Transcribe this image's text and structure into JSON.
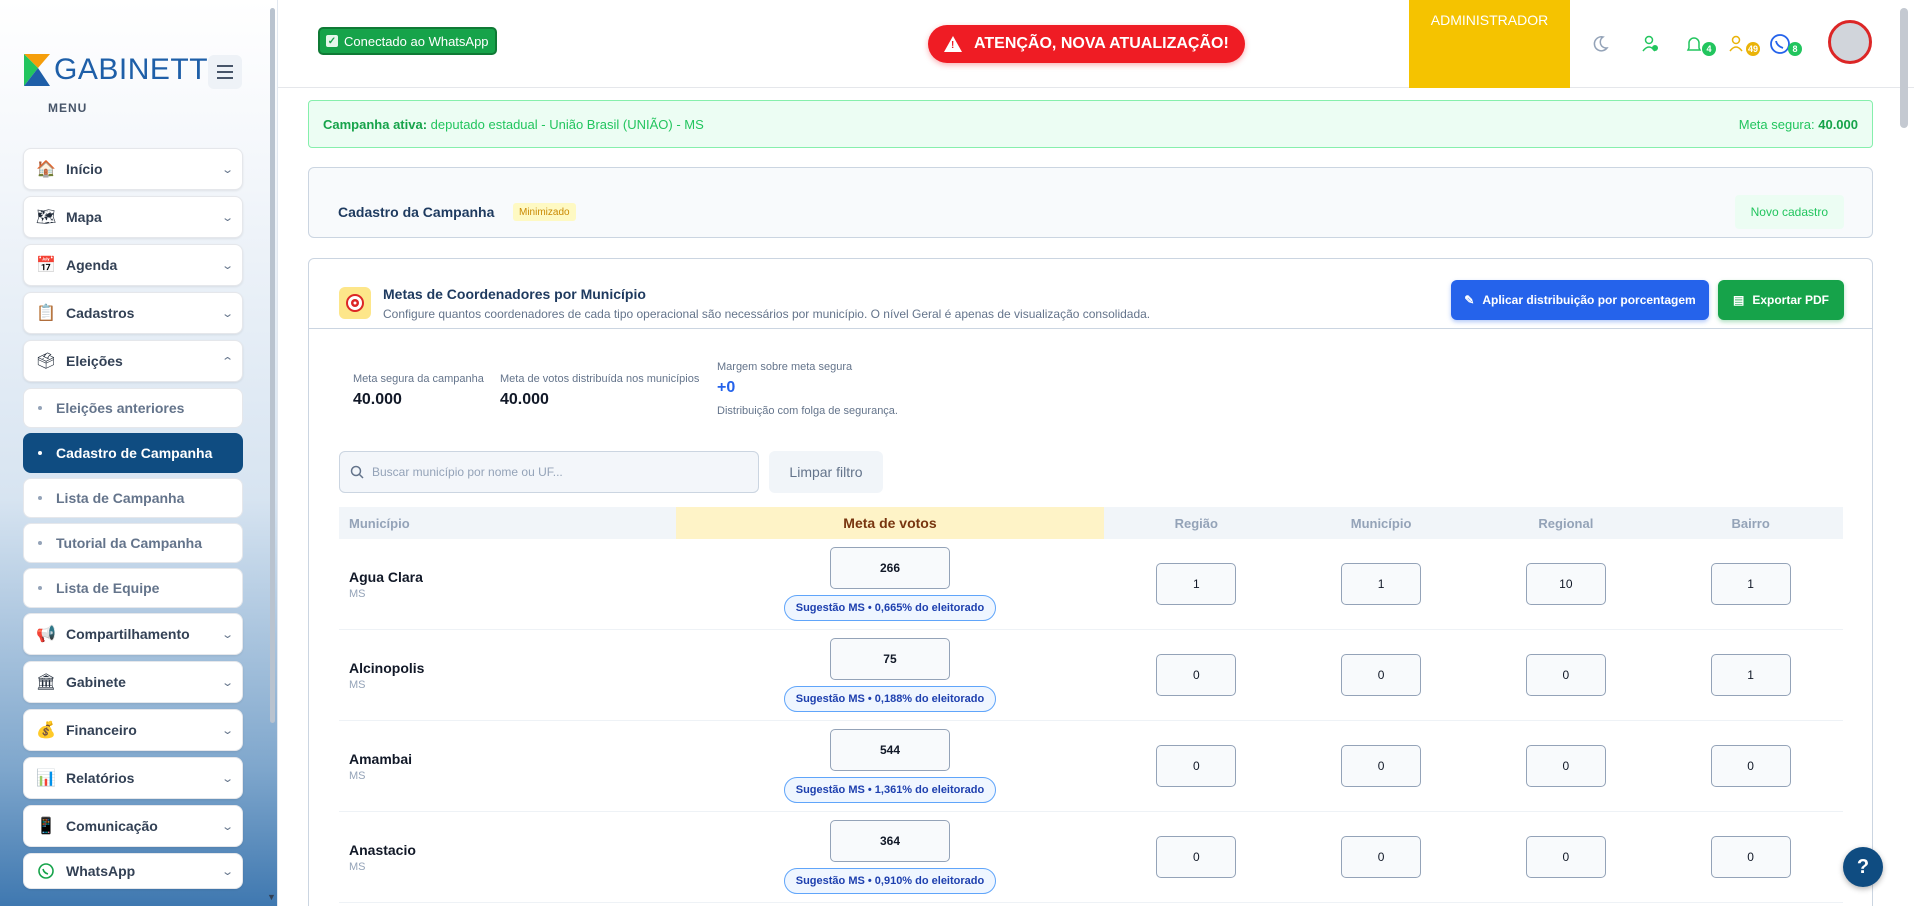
{
  "sidebar": {
    "logo_text": "GABINETT",
    "menu_label": "MENU",
    "items": [
      {
        "label": "Início",
        "icon": "home-icon"
      },
      {
        "label": "Mapa",
        "icon": "map-icon"
      },
      {
        "label": "Agenda",
        "icon": "calendar-icon"
      },
      {
        "label": "Cadastros",
        "icon": "clipboard-icon"
      },
      {
        "label": "Eleições",
        "icon": "ballot-box-icon"
      }
    ],
    "eleicoes_sub": [
      {
        "label": "Eleições anteriores"
      },
      {
        "label": "Cadastro de Campanha"
      },
      {
        "label": "Lista de Campanha"
      },
      {
        "label": "Tutorial da Campanha"
      },
      {
        "label": "Lista de Equipe"
      }
    ],
    "items_after": [
      {
        "label": "Compartilhamento",
        "icon": "megaphone-icon"
      },
      {
        "label": "Gabinete",
        "icon": "bank-icon"
      },
      {
        "label": "Financeiro",
        "icon": "money-bag-icon"
      },
      {
        "label": "Relatórios",
        "icon": "bar-chart-icon"
      },
      {
        "label": "Comunicação",
        "icon": "phone-icon"
      },
      {
        "label": "WhatsApp",
        "icon": "whatsapp-icon"
      }
    ]
  },
  "topbar": {
    "whatsapp_status": "Conectado ao WhatsApp",
    "alert": "ATENÇÃO, NOVA ATUALIZAÇÃO!",
    "role": "ADMINISTRADOR",
    "notifications_count": "4",
    "users_count": "49",
    "whatsapp_count": "8"
  },
  "banner": {
    "active_label": "Campanha ativa:",
    "active_value": "deputado estadual - União Brasil (UNIÃO) - MS",
    "meta_label": "Meta segura:",
    "meta_value": "40.000"
  },
  "cadastro": {
    "title": "Cadastro da Campanha",
    "badge": "Minimizado",
    "new_button": "Novo cadastro"
  },
  "metas": {
    "title": "Metas de Coordenadores por Município",
    "subtitle": "Configure quantos coordenadores de cada tipo operacional são necessários por município. O nível Geral é apenas de visualização consolidada.",
    "apply_button": "Aplicar distribuição por porcentagem",
    "pdf_button": "Exportar PDF",
    "stats": {
      "meta_segura_label": "Meta segura da campanha",
      "meta_segura_value": "40.000",
      "meta_dist_label": "Meta de votos distribuída nos municípios",
      "meta_dist_value": "40.000",
      "margem_label": "Margem sobre meta segura",
      "margem_value": "+0",
      "margem_note": "Distribuição com folga de segurança."
    },
    "search_placeholder": "Buscar município por nome ou UF...",
    "clear_button": "Limpar filtro",
    "columns": [
      "Município",
      "Meta de votos",
      "Região",
      "Município",
      "Regional",
      "Bairro"
    ],
    "rows": [
      {
        "name": "Agua Clara",
        "uf": "MS",
        "meta": "266",
        "suggestion": "Sugestão MS • 0,665% do eleitorado",
        "regiao": "1",
        "municipio": "1",
        "regional": "10",
        "bairro": "1"
      },
      {
        "name": "Alcinopolis",
        "uf": "MS",
        "meta": "75",
        "suggestion": "Sugestão MS • 0,188% do eleitorado",
        "regiao": "0",
        "municipio": "0",
        "regional": "0",
        "bairro": "1"
      },
      {
        "name": "Amambai",
        "uf": "MS",
        "meta": "544",
        "suggestion": "Sugestão MS • 1,361% do eleitorado",
        "regiao": "0",
        "municipio": "0",
        "regional": "0",
        "bairro": "0"
      },
      {
        "name": "Anastacio",
        "uf": "MS",
        "meta": "364",
        "suggestion": "Sugestão MS • 0,910% do eleitorado",
        "regiao": "0",
        "municipio": "0",
        "regional": "0",
        "bairro": "0"
      }
    ]
  },
  "help_label": "?"
}
